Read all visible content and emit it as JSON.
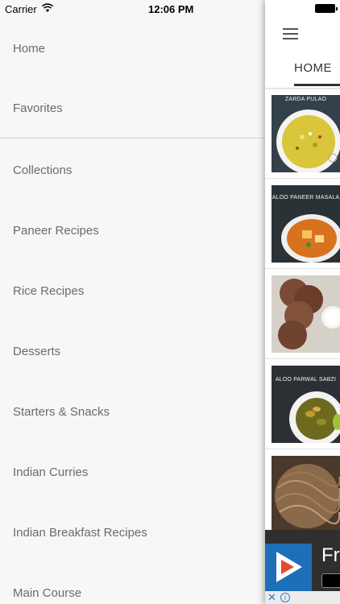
{
  "status_bar": {
    "carrier": "Carrier",
    "time": "12:06 PM"
  },
  "drawer": {
    "items": [
      {
        "label": "Home"
      },
      {
        "label": "Favorites"
      },
      {
        "label": "Collections"
      },
      {
        "label": "Paneer Recipes"
      },
      {
        "label": "Rice Recipes"
      },
      {
        "label": "Desserts"
      },
      {
        "label": "Starters & Snacks"
      },
      {
        "label": "Indian Curries"
      },
      {
        "label": "Indian Breakfast Recipes"
      },
      {
        "label": "Main Course"
      }
    ]
  },
  "main": {
    "tab_label": "HOME",
    "feed": [
      {
        "caption": "ZARDA PULAO"
      },
      {
        "caption": "ALOO PANEER MASALA"
      },
      {
        "caption": ""
      },
      {
        "caption": "ALOO PARWAL SABZI"
      },
      {
        "caption": ""
      }
    ],
    "ad": {
      "text": "Fr"
    }
  },
  "colors": {
    "drawer_bg": "#f7f7f7",
    "drawer_text": "#6b6b6b",
    "ad_logo": "#1d6fb8"
  }
}
